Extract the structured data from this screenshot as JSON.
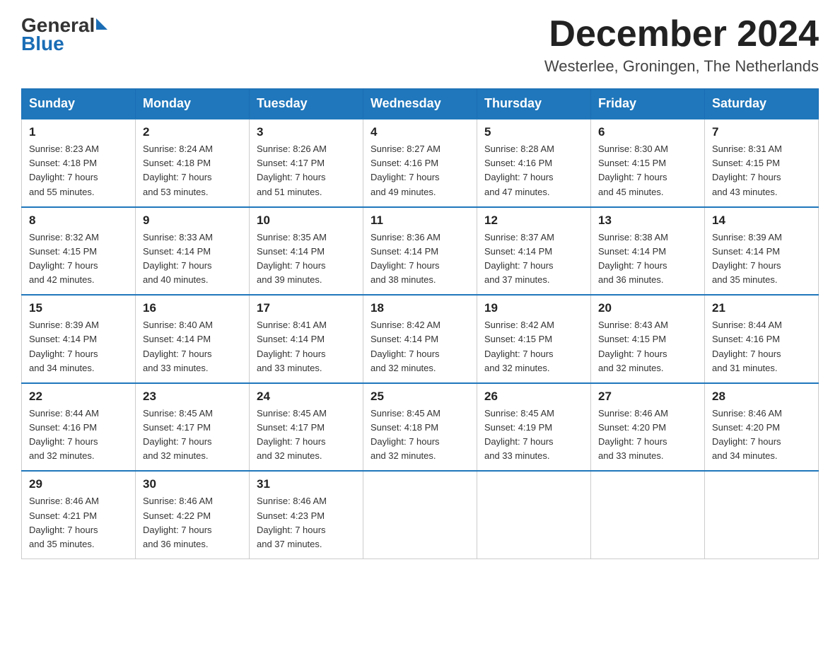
{
  "header": {
    "logo_general": "General",
    "logo_blue": "Blue",
    "month_year": "December 2024",
    "location": "Westerlee, Groningen, The Netherlands"
  },
  "weekdays": [
    "Sunday",
    "Monday",
    "Tuesday",
    "Wednesday",
    "Thursday",
    "Friday",
    "Saturday"
  ],
  "weeks": [
    [
      {
        "day": "1",
        "sunrise": "Sunrise: 8:23 AM",
        "sunset": "Sunset: 4:18 PM",
        "daylight": "Daylight: 7 hours",
        "daylight2": "and 55 minutes."
      },
      {
        "day": "2",
        "sunrise": "Sunrise: 8:24 AM",
        "sunset": "Sunset: 4:18 PM",
        "daylight": "Daylight: 7 hours",
        "daylight2": "and 53 minutes."
      },
      {
        "day": "3",
        "sunrise": "Sunrise: 8:26 AM",
        "sunset": "Sunset: 4:17 PM",
        "daylight": "Daylight: 7 hours",
        "daylight2": "and 51 minutes."
      },
      {
        "day": "4",
        "sunrise": "Sunrise: 8:27 AM",
        "sunset": "Sunset: 4:16 PM",
        "daylight": "Daylight: 7 hours",
        "daylight2": "and 49 minutes."
      },
      {
        "day": "5",
        "sunrise": "Sunrise: 8:28 AM",
        "sunset": "Sunset: 4:16 PM",
        "daylight": "Daylight: 7 hours",
        "daylight2": "and 47 minutes."
      },
      {
        "day": "6",
        "sunrise": "Sunrise: 8:30 AM",
        "sunset": "Sunset: 4:15 PM",
        "daylight": "Daylight: 7 hours",
        "daylight2": "and 45 minutes."
      },
      {
        "day": "7",
        "sunrise": "Sunrise: 8:31 AM",
        "sunset": "Sunset: 4:15 PM",
        "daylight": "Daylight: 7 hours",
        "daylight2": "and 43 minutes."
      }
    ],
    [
      {
        "day": "8",
        "sunrise": "Sunrise: 8:32 AM",
        "sunset": "Sunset: 4:15 PM",
        "daylight": "Daylight: 7 hours",
        "daylight2": "and 42 minutes."
      },
      {
        "day": "9",
        "sunrise": "Sunrise: 8:33 AM",
        "sunset": "Sunset: 4:14 PM",
        "daylight": "Daylight: 7 hours",
        "daylight2": "and 40 minutes."
      },
      {
        "day": "10",
        "sunrise": "Sunrise: 8:35 AM",
        "sunset": "Sunset: 4:14 PM",
        "daylight": "Daylight: 7 hours",
        "daylight2": "and 39 minutes."
      },
      {
        "day": "11",
        "sunrise": "Sunrise: 8:36 AM",
        "sunset": "Sunset: 4:14 PM",
        "daylight": "Daylight: 7 hours",
        "daylight2": "and 38 minutes."
      },
      {
        "day": "12",
        "sunrise": "Sunrise: 8:37 AM",
        "sunset": "Sunset: 4:14 PM",
        "daylight": "Daylight: 7 hours",
        "daylight2": "and 37 minutes."
      },
      {
        "day": "13",
        "sunrise": "Sunrise: 8:38 AM",
        "sunset": "Sunset: 4:14 PM",
        "daylight": "Daylight: 7 hours",
        "daylight2": "and 36 minutes."
      },
      {
        "day": "14",
        "sunrise": "Sunrise: 8:39 AM",
        "sunset": "Sunset: 4:14 PM",
        "daylight": "Daylight: 7 hours",
        "daylight2": "and 35 minutes."
      }
    ],
    [
      {
        "day": "15",
        "sunrise": "Sunrise: 8:39 AM",
        "sunset": "Sunset: 4:14 PM",
        "daylight": "Daylight: 7 hours",
        "daylight2": "and 34 minutes."
      },
      {
        "day": "16",
        "sunrise": "Sunrise: 8:40 AM",
        "sunset": "Sunset: 4:14 PM",
        "daylight": "Daylight: 7 hours",
        "daylight2": "and 33 minutes."
      },
      {
        "day": "17",
        "sunrise": "Sunrise: 8:41 AM",
        "sunset": "Sunset: 4:14 PM",
        "daylight": "Daylight: 7 hours",
        "daylight2": "and 33 minutes."
      },
      {
        "day": "18",
        "sunrise": "Sunrise: 8:42 AM",
        "sunset": "Sunset: 4:14 PM",
        "daylight": "Daylight: 7 hours",
        "daylight2": "and 32 minutes."
      },
      {
        "day": "19",
        "sunrise": "Sunrise: 8:42 AM",
        "sunset": "Sunset: 4:15 PM",
        "daylight": "Daylight: 7 hours",
        "daylight2": "and 32 minutes."
      },
      {
        "day": "20",
        "sunrise": "Sunrise: 8:43 AM",
        "sunset": "Sunset: 4:15 PM",
        "daylight": "Daylight: 7 hours",
        "daylight2": "and 32 minutes."
      },
      {
        "day": "21",
        "sunrise": "Sunrise: 8:44 AM",
        "sunset": "Sunset: 4:16 PM",
        "daylight": "Daylight: 7 hours",
        "daylight2": "and 31 minutes."
      }
    ],
    [
      {
        "day": "22",
        "sunrise": "Sunrise: 8:44 AM",
        "sunset": "Sunset: 4:16 PM",
        "daylight": "Daylight: 7 hours",
        "daylight2": "and 32 minutes."
      },
      {
        "day": "23",
        "sunrise": "Sunrise: 8:45 AM",
        "sunset": "Sunset: 4:17 PM",
        "daylight": "Daylight: 7 hours",
        "daylight2": "and 32 minutes."
      },
      {
        "day": "24",
        "sunrise": "Sunrise: 8:45 AM",
        "sunset": "Sunset: 4:17 PM",
        "daylight": "Daylight: 7 hours",
        "daylight2": "and 32 minutes."
      },
      {
        "day": "25",
        "sunrise": "Sunrise: 8:45 AM",
        "sunset": "Sunset: 4:18 PM",
        "daylight": "Daylight: 7 hours",
        "daylight2": "and 32 minutes."
      },
      {
        "day": "26",
        "sunrise": "Sunrise: 8:45 AM",
        "sunset": "Sunset: 4:19 PM",
        "daylight": "Daylight: 7 hours",
        "daylight2": "and 33 minutes."
      },
      {
        "day": "27",
        "sunrise": "Sunrise: 8:46 AM",
        "sunset": "Sunset: 4:20 PM",
        "daylight": "Daylight: 7 hours",
        "daylight2": "and 33 minutes."
      },
      {
        "day": "28",
        "sunrise": "Sunrise: 8:46 AM",
        "sunset": "Sunset: 4:20 PM",
        "daylight": "Daylight: 7 hours",
        "daylight2": "and 34 minutes."
      }
    ],
    [
      {
        "day": "29",
        "sunrise": "Sunrise: 8:46 AM",
        "sunset": "Sunset: 4:21 PM",
        "daylight": "Daylight: 7 hours",
        "daylight2": "and 35 minutes."
      },
      {
        "day": "30",
        "sunrise": "Sunrise: 8:46 AM",
        "sunset": "Sunset: 4:22 PM",
        "daylight": "Daylight: 7 hours",
        "daylight2": "and 36 minutes."
      },
      {
        "day": "31",
        "sunrise": "Sunrise: 8:46 AM",
        "sunset": "Sunset: 4:23 PM",
        "daylight": "Daylight: 7 hours",
        "daylight2": "and 37 minutes."
      },
      null,
      null,
      null,
      null
    ]
  ]
}
